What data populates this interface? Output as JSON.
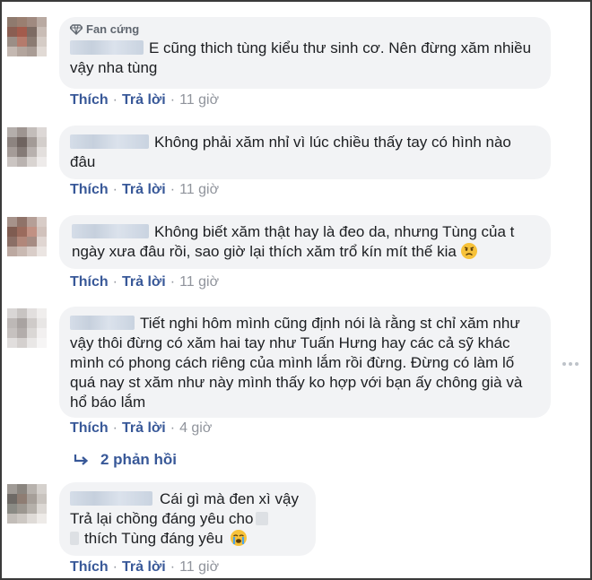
{
  "colors": {
    "link": "#385898",
    "bubble": "#f2f3f5",
    "meta": "#90949c"
  },
  "comments": [
    {
      "badge": "Fan cứng",
      "text": "E cũng thich tùng kiểu thư sinh cơ. Nên đừng xăm nhiều vậy nha tùng",
      "like": "Thích",
      "reply": "Trả lời",
      "time": "11 giờ"
    },
    {
      "text": "Không phải xăm nhỉ vì lúc chiều thấy tay có hình nào đâu",
      "like": "Thích",
      "reply": "Trả lời",
      "time": "11 giờ"
    },
    {
      "text": "Không biết xăm thật hay là đeo da, nhưng Tùng của t ngày xưa đâu rồi, sao giờ lại thích xăm trổ kín mít thế kia",
      "emoji": "sad-face",
      "like": "Thích",
      "reply": "Trả lời",
      "time": "11 giờ"
    },
    {
      "text": "Tiết nghi hôm mình cũng định nói là rằng st chỉ xăm như vậy thôi đừng có xăm hai tay như Tuấn Hưng hay các cả sỹ khác mình có phong cách riêng của mình lắm rồi đừng. Đừng có làm lố quá nay st xăm như này mình thấy ko hợp với bạn ấy chông già và hổ báo lắm",
      "like": "Thích",
      "reply": "Trả lời",
      "time": "4 giờ"
    },
    {
      "line1": "Cái gì mà đen xì vậy",
      "line2": "Trả lại chồng đáng yêu cho",
      "line3": "thích Tùng đáng yêu",
      "emoji": "crying-face",
      "like": "Thích",
      "reply": "Trả lời",
      "time": "11 giờ"
    }
  ],
  "replies": {
    "label": "2 phản hồi",
    "icon": "reply-arrow-icon"
  },
  "more_icon": "more-options-icon"
}
